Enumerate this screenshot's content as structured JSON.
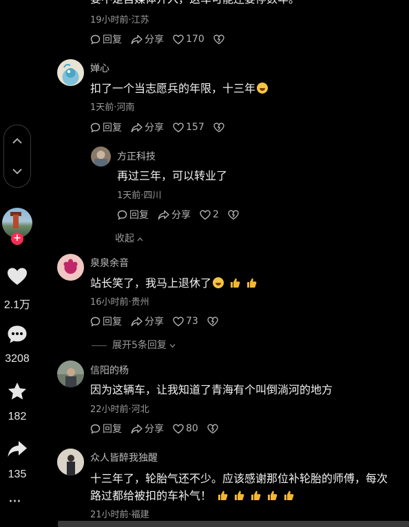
{
  "rail": {
    "like_count": "2.1万",
    "comment_count": "3208",
    "favorite_count": "182",
    "share_count": "135",
    "follow_badge": "+",
    "more_label": "···"
  },
  "actions": {
    "reply": "回复",
    "share": "分享"
  },
  "top_comment": {
    "text": "要不是自媒体介入，这车可能还要停数年。",
    "meta": "19小时前·江苏",
    "likes": "170"
  },
  "comments": [
    {
      "author": "婵心",
      "text": "扣了一个当志愿兵的年限，十三年",
      "meta": "1天前·河南",
      "likes": "157"
    },
    {
      "author": "泉泉余音",
      "text": "站长笑了，我马上退休了",
      "meta": "16小时前·贵州",
      "likes": "73",
      "expand_label": "展开5条回复"
    },
    {
      "author": "信阳的杨",
      "text": "因为这辆车，让我知道了青海有个叫倒淌河的地方",
      "meta": "22小时前·河北",
      "likes": "80"
    },
    {
      "author": "众人皆醉我独醒",
      "text_line1": "十三年了，轮胎气还不少。应该感谢那位补轮胎的师傅，每次",
      "text_line2": "路过都给被扣的车补气！",
      "meta": "21小时前·福建"
    }
  ],
  "reply": {
    "author": "方正科技",
    "text": "再过三年，可以转业了",
    "meta": "1天前·四川",
    "likes": "2",
    "collapse_label": "收起"
  }
}
